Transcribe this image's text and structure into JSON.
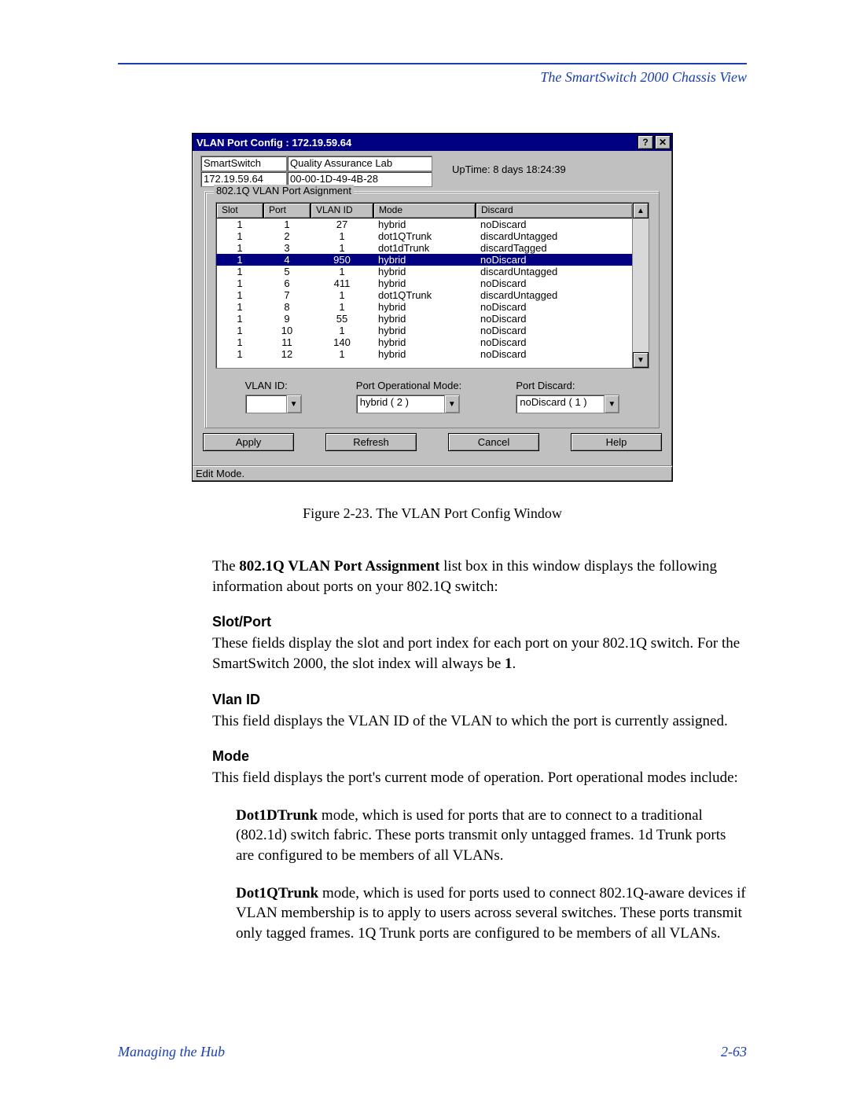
{
  "header": {
    "title": "The SmartSwitch 2000 Chassis View"
  },
  "dialog": {
    "title": "VLAN Port Config : 172.19.59.64",
    "help_btn": "?",
    "close_btn": "✕",
    "device_name": "SmartSwitch",
    "ip": "172.19.59.64",
    "location": "Quality Assurance Lab",
    "mac": "00-00-1D-49-4B-28",
    "uptime": "UpTime: 8 days 18:24:39",
    "group_caption": "802.1Q VLAN Port Asignment",
    "columns": {
      "slot": "Slot",
      "port": "Port",
      "vlan": "VLAN ID",
      "mode": "Mode",
      "discard": "Discard"
    },
    "rows": [
      {
        "slot": "1",
        "port": "1",
        "vlan": "27",
        "mode": "hybrid",
        "discard": "noDiscard",
        "sel": false
      },
      {
        "slot": "1",
        "port": "2",
        "vlan": "1",
        "mode": "dot1QTrunk",
        "discard": "discardUntagged",
        "sel": false
      },
      {
        "slot": "1",
        "port": "3",
        "vlan": "1",
        "mode": "dot1dTrunk",
        "discard": "discardTagged",
        "sel": false
      },
      {
        "slot": "1",
        "port": "4",
        "vlan": "950",
        "mode": "hybrid",
        "discard": "noDiscard",
        "sel": true
      },
      {
        "slot": "1",
        "port": "5",
        "vlan": "1",
        "mode": "hybrid",
        "discard": "discardUntagged",
        "sel": false
      },
      {
        "slot": "1",
        "port": "6",
        "vlan": "411",
        "mode": "hybrid",
        "discard": "noDiscard",
        "sel": false
      },
      {
        "slot": "1",
        "port": "7",
        "vlan": "1",
        "mode": "dot1QTrunk",
        "discard": "discardUntagged",
        "sel": false
      },
      {
        "slot": "1",
        "port": "8",
        "vlan": "1",
        "mode": "hybrid",
        "discard": "noDiscard",
        "sel": false
      },
      {
        "slot": "1",
        "port": "9",
        "vlan": "55",
        "mode": "hybrid",
        "discard": "noDiscard",
        "sel": false
      },
      {
        "slot": "1",
        "port": "10",
        "vlan": "1",
        "mode": "hybrid",
        "discard": "noDiscard",
        "sel": false
      },
      {
        "slot": "1",
        "port": "11",
        "vlan": "140",
        "mode": "hybrid",
        "discard": "noDiscard",
        "sel": false
      },
      {
        "slot": "1",
        "port": "12",
        "vlan": "1",
        "mode": "hybrid",
        "discard": "noDiscard",
        "sel": false
      }
    ],
    "fields": {
      "vlan_label": "VLAN ID:",
      "vlan_value": "",
      "mode_label": "Port Operational Mode:",
      "mode_value": "hybrid ( 2 )",
      "discard_label": "Port Discard:",
      "discard_value": "noDiscard ( 1 )"
    },
    "buttons": {
      "apply": "Apply",
      "refresh": "Refresh",
      "cancel": "Cancel",
      "help": "Help"
    },
    "status": "Edit Mode."
  },
  "caption": "Figure 2-23. The VLAN Port Config Window",
  "body": {
    "intro1a": "The ",
    "intro1b": "802.1Q VLAN Port Assignment",
    "intro1c": " list box in this window displays the following information about ports on your 802.1Q switch:",
    "h_slotport": "Slot/Port",
    "p_slotport1": "These fields display the slot and port index for each port on your 802.1Q switch. For the SmartSwitch 2000, the slot index will always be ",
    "p_slotport_bold": "1",
    "p_slotport2": ".",
    "h_vlan": "Vlan ID",
    "p_vlan": "This field displays the VLAN ID of the VLAN to which the port is currently assigned.",
    "h_mode": "Mode",
    "p_mode": "This field displays the port's current mode of operation. Port operational modes include:",
    "p_d1a": "Dot1DTrunk",
    "p_d1b": " mode, which is used for ports that are to connect to a traditional (802.1d) switch fabric. These ports transmit only untagged frames. 1d Trunk ports are configured to be members of all VLANs.",
    "p_q1a": "Dot1QTrunk",
    "p_q1b": " mode, which is used for ports used to connect 802.1Q-aware devices if VLAN membership is to apply to users across several switches. These ports transmit only tagged frames. 1Q Trunk ports are configured to be members of all VLANs."
  },
  "footer": {
    "left": "Managing the Hub",
    "right": "2-63"
  }
}
